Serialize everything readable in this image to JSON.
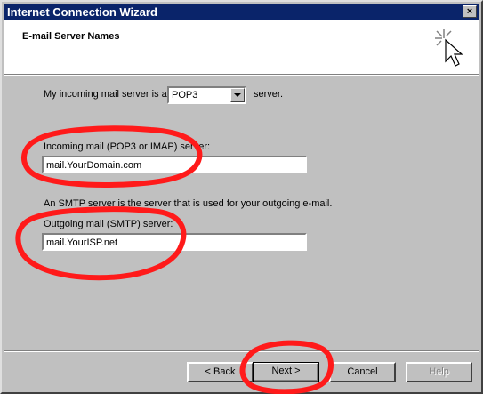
{
  "window": {
    "title": "Internet Connection Wizard",
    "close_label": "×"
  },
  "header": {
    "title": "E-mail Server Names"
  },
  "server_type": {
    "prefix": "My incoming mail server is a",
    "selected": "POP3",
    "suffix": "server."
  },
  "incoming": {
    "label": "Incoming mail (POP3 or IMAP) server:",
    "value": "mail.YourDomain.com"
  },
  "smtp_note": "An SMTP server is the server that is used for your outgoing e-mail.",
  "outgoing": {
    "label": "Outgoing mail (SMTP) server:",
    "value": "mail.YourISP.net"
  },
  "buttons": {
    "back": "< Back",
    "next": "Next >",
    "cancel": "Cancel",
    "help": "Help"
  },
  "colors": {
    "titlebar": "#0a246a",
    "annotation": "#ff1a1a"
  }
}
